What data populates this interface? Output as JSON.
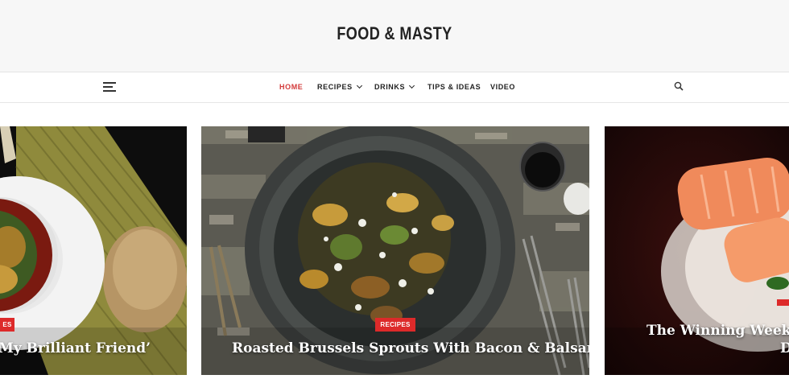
{
  "site": {
    "title": "FOOD & MASTY"
  },
  "nav": {
    "items": [
      {
        "label": "HOME",
        "active": true,
        "dropdown": false
      },
      {
        "label": "RECIPES",
        "active": false,
        "dropdown": true
      },
      {
        "label": "DRINKS",
        "active": false,
        "dropdown": true
      },
      {
        "label": "TIPS & IDEAS",
        "active": false,
        "dropdown": false
      },
      {
        "label": "VIDEO",
        "active": false,
        "dropdown": false
      }
    ],
    "menu_icon": "hamburger-icon",
    "search_icon": "search-icon"
  },
  "slider": {
    "cards": [
      {
        "category": "ES",
        "title": "My Brilliant Friend’"
      },
      {
        "category": "RECIPES",
        "title": "Roasted Brussels Sprouts With Bacon & Balsamic"
      },
      {
        "category": "",
        "title": "The Winning Weeknig",
        "title_line2": "D"
      }
    ]
  },
  "colors": {
    "accent": "#dd2a2a",
    "active_nav": "#d33a3a",
    "header_bg": "#f7f7f7"
  }
}
